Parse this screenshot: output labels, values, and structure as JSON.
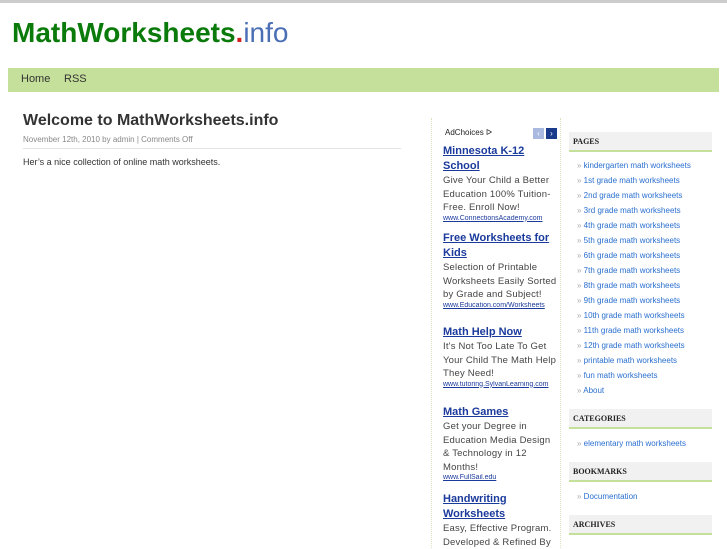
{
  "logo": {
    "name": "MathWorksheets",
    "dot": ".",
    "tld": "info"
  },
  "nav": [
    "Home",
    "RSS"
  ],
  "post": {
    "title": "Welcome to MathWorksheets.info",
    "meta": "November 12th, 2010 by admin | Comments Off",
    "body": "Her’s a nice collection of online math worksheets."
  },
  "ads": {
    "adchoices": "AdChoices ᐅ",
    "prev": "‹",
    "next": "›",
    "items": [
      {
        "title": "Minnesota K-12 School",
        "desc": "Give Your Child a Better Education 100% Tuition-Free. Enroll Now!",
        "url": "www.ConnectionsAcademy.com"
      },
      {
        "title": "Free Worksheets for Kids",
        "desc": "Selection of Printable Worksheets Easily Sorted by Grade and Subject!",
        "url": "www.Education.com/Worksheets"
      },
      {
        "title": "Math Help Now",
        "desc": "It's Not Too Late To Get Your Child The Math Help They Need!",
        "url": "www.tutoring.SylvanLearning.com"
      },
      {
        "title": "Math Games",
        "desc": "Get your Degree in Education Media Design & Technology in 12 Months!",
        "url": "www.FullSail.edu"
      },
      {
        "title": "Handwriting Worksheets",
        "desc": "Easy, Effective Program. Developed & Refined By",
        "url": ""
      }
    ]
  },
  "sidebar": {
    "pages_title": "PAGES",
    "pages": [
      "kindergarten math worksheets",
      "1st grade math worksheets",
      "2nd grade math worksheets",
      "3rd grade math worksheets",
      "4th grade math worksheets",
      "5th grade math worksheets",
      "6th grade math worksheets",
      "7th grade math worksheets",
      "8th grade math worksheets",
      "9th grade math worksheets",
      "10th grade math worksheets",
      "11th grade math worksheets",
      "12th grade math worksheets",
      "printable math worksheets",
      "fun math worksheets",
      "About"
    ],
    "categories_title": "CATEGORIES",
    "categories": [
      "elementary math worksheets"
    ],
    "bookmarks_title": "BOOKMARKS",
    "bookmarks": [
      "Documentation"
    ],
    "archives_title": "ARCHIVES"
  }
}
